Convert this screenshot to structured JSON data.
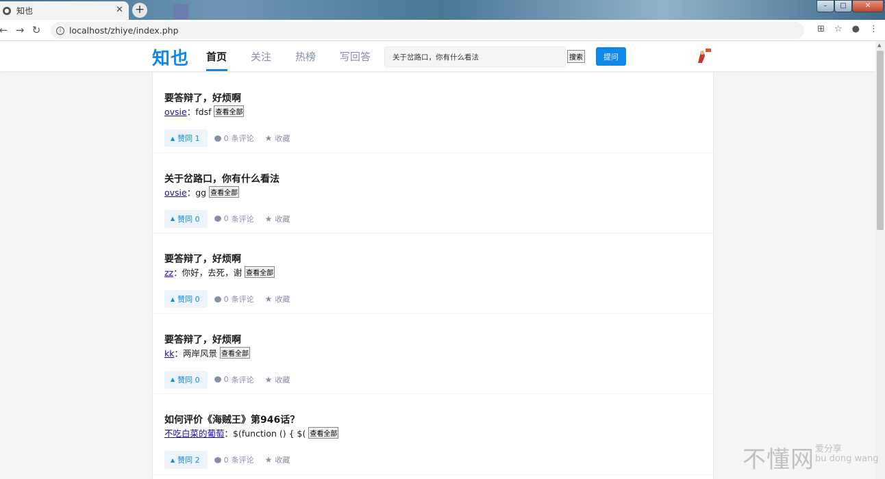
{
  "browser": {
    "tab_title": "知也",
    "url": "localhost/zhiye/index.php"
  },
  "header": {
    "logo": "知也",
    "nav": [
      "首页",
      "关注",
      "热榜",
      "写回答"
    ],
    "search_value": "关于岔路口，你有什么看法",
    "search_button": "搜索",
    "ask_button": "提问"
  },
  "feed": [
    {
      "title": "要答辩了，好烦啊",
      "author": "ovsie",
      "excerpt": "：fdsf",
      "more": "查看全部",
      "vote": "赞同 1",
      "comments_count": "0",
      "comments_label": "条评论",
      "favorite": "收藏"
    },
    {
      "title": "关于岔路口，你有什么看法",
      "author": "ovsie",
      "excerpt": "：gg",
      "more": "查看全部",
      "vote": "赞同 0",
      "comments_count": "0",
      "comments_label": "条评论",
      "favorite": "收藏"
    },
    {
      "title": "要答辩了，好烦啊",
      "author": "zz",
      "excerpt": "：你好，去死，谢",
      "more": "查看全部",
      "vote": "赞同 0",
      "comments_count": "0",
      "comments_label": "条评论",
      "favorite": "收藏"
    },
    {
      "title": "要答辩了，好烦啊",
      "author": "kk",
      "excerpt": "：两岸风景",
      "more": "查看全部",
      "vote": "赞同 0",
      "comments_count": "0",
      "comments_label": "条评论",
      "favorite": "收藏"
    },
    {
      "title": "如何评价《海贼王》第946话？",
      "author": "不吃白菜的葡萄",
      "excerpt": "：$(function () { $(",
      "more": "查看全部",
      "vote": "赞同 2",
      "comments_count": "0",
      "comments_label": "条评论",
      "favorite": "收藏"
    }
  ],
  "watermark": {
    "main": "不懂网",
    "side_top": "爱分享",
    "side_bottom": "bu dong wang"
  },
  "colors": {
    "accent": "#0f88eb",
    "muted": "#8590a6",
    "link": "#1a0dab"
  }
}
